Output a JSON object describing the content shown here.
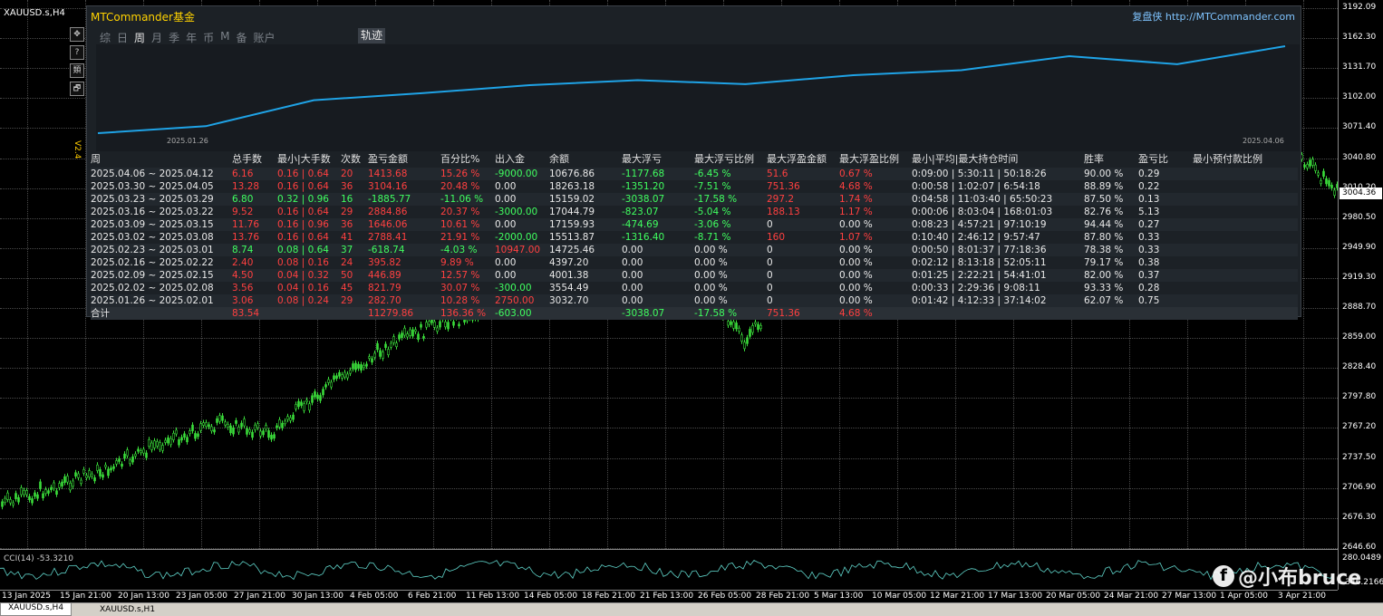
{
  "symbol": "XAUUSD.s,H4",
  "price_axis": [
    "3192.09",
    "3162.30",
    "3131.70",
    "3102.00",
    "3071.40",
    "3040.80",
    "3010.20",
    "2980.50",
    "2949.90",
    "2919.30",
    "2888.70",
    "2859.00",
    "2828.40",
    "2797.80",
    "2767.20",
    "2737.50",
    "2706.90",
    "2676.30",
    "2646.60"
  ],
  "current_price": "3004.36",
  "cci": {
    "label": "CCI(14) -53.3210",
    "top": "280.0489",
    "bottom": "-346.2166"
  },
  "time_axis": [
    "13 Jan 2025",
    "15 Jan 21:00",
    "20 Jan 13:00",
    "23 Jan 05:00",
    "27 Jan 21:00",
    "30 Jan 13:00",
    "4 Feb 05:00",
    "6 Feb 21:00",
    "11 Feb 13:00",
    "14 Feb 05:00",
    "18 Feb 21:00",
    "21 Feb 13:00",
    "26 Feb 05:00",
    "28 Feb 21:00",
    "5 Mar 13:00",
    "10 Mar 05:00",
    "12 Mar 21:00",
    "17 Mar 13:00",
    "20 Mar 05:00",
    "24 Mar 21:00",
    "27 Mar 13:00",
    "1 Apr 05:00",
    "3 Apr 21:00"
  ],
  "bottom_tabs": [
    "XAUUSD.s,H4",
    "XAUUSD.s,H1"
  ],
  "watermark": "@小布bruce",
  "left_tools": [
    "✥",
    "?",
    "類",
    "🗗"
  ],
  "side_label": "V2.4",
  "panel": {
    "title": "MTCommander基金",
    "link_prefix": "复盘侠",
    "link": "http://MTCommander.com",
    "tabs": [
      "综",
      "日",
      "周",
      "月",
      "季",
      "年",
      "币",
      "M",
      "备",
      "账户"
    ],
    "active_tab": "周",
    "traj_button": "轨迹",
    "mini_chart": {
      "start_date": "2025.01.26",
      "end_date": "2025.04.06",
      "line_color": "#1fa3e6",
      "values": [
        3071,
        3078,
        3104,
        3111,
        3119,
        3124,
        3120,
        3129,
        3134,
        3148,
        3140,
        3158
      ]
    },
    "headers": [
      "周",
      "总手数",
      "最小|大手数",
      "次数",
      "盈亏金额",
      "百分比%",
      "出入金",
      "余额",
      "最大浮亏",
      "最大浮亏比例",
      "最大浮盈金额",
      "最大浮盈比例",
      "最小|平均|最大持仓时间",
      "胜率",
      "盈亏比",
      "最小预付款比例"
    ],
    "rows": [
      [
        "2025.04.06 ~ 2025.04.12",
        "6.16",
        "0.16 | 0.64",
        "20",
        "1413.68",
        "15.26 %",
        "-9000.00",
        "10676.86",
        "-1177.68",
        "-6.45 %",
        "51.6",
        "0.67 %",
        "0:09:00 | 5:30:11 | 50:18:26",
        "90.00 %",
        "0.29",
        ""
      ],
      [
        "2025.03.30 ~ 2025.04.05",
        "13.28",
        "0.16 | 0.64",
        "36",
        "3104.16",
        "20.48 %",
        "0.00",
        "18263.18",
        "-1351.20",
        "-7.51 %",
        "751.36",
        "4.68 %",
        "0:00:58 | 1:02:07 | 6:54:18",
        "88.89 %",
        "0.22",
        ""
      ],
      [
        "2025.03.23 ~ 2025.03.29",
        "6.80",
        "0.32 | 0.96",
        "16",
        "-1885.77",
        "-11.06 %",
        "0.00",
        "15159.02",
        "-3038.07",
        "-17.58 %",
        "297.2",
        "1.74 %",
        "0:04:58 | 11:03:40 | 65:50:23",
        "87.50 %",
        "0.13",
        ""
      ],
      [
        "2025.03.16 ~ 2025.03.22",
        "9.52",
        "0.16 | 0.64",
        "29",
        "2884.86",
        "20.37 %",
        "-3000.00",
        "17044.79",
        "-823.07",
        "-5.04 %",
        "188.13",
        "1.17 %",
        "0:00:06 | 8:03:04 | 168:01:03",
        "82.76 %",
        "5.13",
        ""
      ],
      [
        "2025.03.09 ~ 2025.03.15",
        "11.76",
        "0.16 | 0.96",
        "36",
        "1646.06",
        "10.61 %",
        "0.00",
        "17159.93",
        "-474.69",
        "-3.06 %",
        "0",
        "0.00 %",
        "0:08:23 | 4:57:21 | 97:10:19",
        "94.44 %",
        "0.27",
        ""
      ],
      [
        "2025.03.02 ~ 2025.03.08",
        "13.76",
        "0.16 | 0.64",
        "41",
        "2788.41",
        "21.91 %",
        "-2000.00",
        "15513.87",
        "-1316.40",
        "-8.71 %",
        "160",
        "1.07 %",
        "0:10:40 | 2:46:12 | 9:57:47",
        "87.80 %",
        "0.33",
        ""
      ],
      [
        "2025.02.23 ~ 2025.03.01",
        "8.74",
        "0.08 | 0.64",
        "37",
        "-618.74",
        "-4.03 %",
        "10947.00",
        "14725.46",
        "0.00",
        "0.00 %",
        "0",
        "0.00 %",
        "0:00:50 | 8:01:37 | 77:18:36",
        "78.38 %",
        "0.33",
        ""
      ],
      [
        "2025.02.16 ~ 2025.02.22",
        "2.40",
        "0.08 | 0.16",
        "24",
        "395.82",
        "9.89 %",
        "0.00",
        "4397.20",
        "0.00",
        "0.00 %",
        "0",
        "0.00 %",
        "0:02:12 | 8:13:18 | 52:05:11",
        "79.17 %",
        "0.38",
        ""
      ],
      [
        "2025.02.09 ~ 2025.02.15",
        "4.50",
        "0.04 | 0.32",
        "50",
        "446.89",
        "12.57 %",
        "0.00",
        "4001.38",
        "0.00",
        "0.00 %",
        "0",
        "0.00 %",
        "0:01:25 | 2:22:21 | 54:41:01",
        "82.00 %",
        "0.37",
        ""
      ],
      [
        "2025.02.02 ~ 2025.02.08",
        "3.56",
        "0.04 | 0.16",
        "45",
        "821.79",
        "30.07 %",
        "-300.00",
        "3554.49",
        "0.00",
        "0.00 %",
        "0",
        "0.00 %",
        "0:00:33 | 2:29:36 | 9:08:11",
        "93.33 %",
        "0.28",
        ""
      ],
      [
        "2025.01.26 ~ 2025.02.01",
        "3.06",
        "0.08 | 0.24",
        "29",
        "282.70",
        "10.28 %",
        "2750.00",
        "3032.70",
        "0.00",
        "0.00 %",
        "0",
        "0.00 %",
        "0:01:42 | 4:12:33 | 37:14:02",
        "62.07 %",
        "0.75",
        ""
      ]
    ],
    "row_colors": [
      [
        "w",
        "r",
        "r",
        "r",
        "r",
        "r",
        "g",
        "w",
        "g",
        "g",
        "r",
        "r",
        "w",
        "w",
        "w",
        "w"
      ],
      [
        "w",
        "r",
        "r",
        "r",
        "r",
        "r",
        "w",
        "w",
        "g",
        "g",
        "r",
        "r",
        "w",
        "w",
        "w",
        "w"
      ],
      [
        "w",
        "g",
        "g",
        "g",
        "g",
        "g",
        "w",
        "w",
        "g",
        "g",
        "r",
        "r",
        "w",
        "w",
        "w",
        "w"
      ],
      [
        "w",
        "r",
        "r",
        "r",
        "r",
        "r",
        "g",
        "w",
        "g",
        "g",
        "r",
        "r",
        "w",
        "w",
        "w",
        "w"
      ],
      [
        "w",
        "r",
        "r",
        "r",
        "r",
        "r",
        "w",
        "w",
        "g",
        "g",
        "w",
        "w",
        "w",
        "w",
        "w",
        "w"
      ],
      [
        "w",
        "r",
        "r",
        "r",
        "r",
        "r",
        "g",
        "w",
        "g",
        "g",
        "r",
        "r",
        "w",
        "w",
        "w",
        "w"
      ],
      [
        "w",
        "g",
        "g",
        "g",
        "g",
        "g",
        "r",
        "w",
        "w",
        "w",
        "w",
        "w",
        "w",
        "w",
        "w",
        "w"
      ],
      [
        "w",
        "r",
        "r",
        "r",
        "r",
        "r",
        "w",
        "w",
        "w",
        "w",
        "w",
        "w",
        "w",
        "w",
        "w",
        "w"
      ],
      [
        "w",
        "r",
        "r",
        "r",
        "r",
        "r",
        "w",
        "w",
        "w",
        "w",
        "w",
        "w",
        "w",
        "w",
        "w",
        "w"
      ],
      [
        "w",
        "r",
        "r",
        "r",
        "r",
        "r",
        "g",
        "w",
        "w",
        "w",
        "w",
        "w",
        "w",
        "w",
        "w",
        "w"
      ],
      [
        "w",
        "r",
        "r",
        "r",
        "r",
        "r",
        "r",
        "w",
        "w",
        "w",
        "w",
        "w",
        "w",
        "w",
        "w",
        "w"
      ]
    ],
    "total": [
      "合计",
      "83.54",
      "",
      "",
      "11279.86",
      "136.36 %",
      "-603.00",
      "",
      "-3038.07",
      "-17.58 %",
      "751.36",
      "4.68 %",
      "",
      "",
      "",
      ""
    ],
    "total_colors": [
      "w",
      "r",
      "w",
      "w",
      "r",
      "r",
      "g",
      "w",
      "g",
      "g",
      "r",
      "r",
      "w",
      "w",
      "w",
      "w"
    ]
  },
  "colors": {
    "red": "#ff4040",
    "green": "#40ff60",
    "accent": "#ffd200",
    "link": "#7fc4ff"
  }
}
